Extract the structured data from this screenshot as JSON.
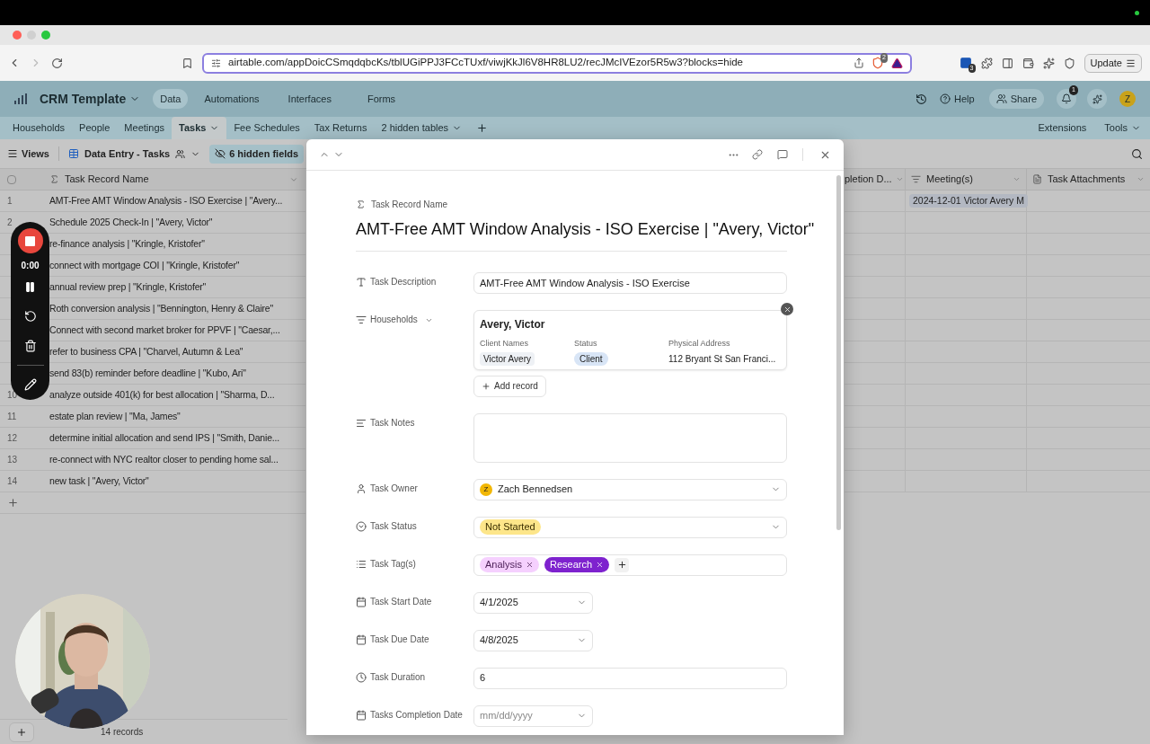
{
  "browser": {
    "url": "airtable.com/appDoicCSmqdqbcKs/tblUGiPPJ3FCcTUxf/viwjKkJl6V8HR8LU2/recJMcIVEzor5R5w3?blocks=hide",
    "shield_count": "2",
    "extension_count": "3",
    "update_label": "Update"
  },
  "app": {
    "base_name": "CRM Template",
    "nav": [
      {
        "label": "Data",
        "selected": true
      },
      {
        "label": "Automations",
        "selected": false
      },
      {
        "label": "Interfaces",
        "selected": false
      },
      {
        "label": "Forms",
        "selected": false
      }
    ],
    "help": "Help",
    "share": "Share",
    "notification_count": "1",
    "avatar_initial": "Z"
  },
  "tables": [
    {
      "label": "Households",
      "selected": false
    },
    {
      "label": "People",
      "selected": false
    },
    {
      "label": "Meetings",
      "selected": false
    },
    {
      "label": "Tasks",
      "selected": true
    },
    {
      "label": "Fee Schedules",
      "selected": false
    },
    {
      "label": "Tax Returns",
      "selected": false
    }
  ],
  "hidden_tables": "2 hidden tables",
  "extensions": "Extensions",
  "tools": "Tools",
  "toolbar": {
    "views": "Views",
    "view_name": "Data Entry - Tasks",
    "hidden_fields": "6 hidden fields"
  },
  "grid": {
    "select_all_checked": false,
    "name_column": "Task Record Name",
    "rows": [
      {
        "number": "1",
        "name": "AMT-Free AMT Window Analysis - ISO Exercise | \"Avery..."
      },
      {
        "number": "2",
        "name": "Schedule 2025 Check-In | \"Avery, Victor\""
      },
      {
        "name": "re-finance analysis | \"Kringle, Kristofer\""
      },
      {
        "name": "connect with mortgage COI | \"Kringle, Kristofer\""
      },
      {
        "name": "annual review prep | \"Kringle, Kristofer\""
      },
      {
        "name": "Roth conversion analysis | \"Bennington, Henry & Claire\""
      },
      {
        "name": "Connect with second market broker for PPVF | \"Caesar,..."
      },
      {
        "name": "refer to business CPA | \"Charvel, Autumn & Lea\""
      },
      {
        "name": "send 83(b) reminder before deadline | \"Kubo, Ari\""
      },
      {
        "number": "10",
        "name": "analyze outside 401(k) for best allocation | \"Sharma, D..."
      },
      {
        "number": "11",
        "name": "estate plan review | \"Ma, James\""
      },
      {
        "number": "12",
        "name": "determine initial allocation and send IPS | \"Smith, Danie..."
      },
      {
        "number": "13",
        "name": "re-connect with NYC realtor closer to pending home sal..."
      },
      {
        "number": "14",
        "name": "new task | \"Avery, Victor\""
      }
    ],
    "right_columns": [
      "pletion D...",
      "Meeting(s)",
      "Task Attachments"
    ],
    "meeting_cell": "2024-12-01 Victor Avery M"
  },
  "recorder": {
    "time": "0:00"
  },
  "footer": {
    "records": "14 records"
  },
  "record": {
    "name_label": "Task Record Name",
    "title": "AMT-Free AMT Window Analysis - ISO Exercise | \"Avery, Victor\"",
    "fields": [
      {
        "kind": "text",
        "label": "Task Description",
        "value": "AMT-Free AMT Window Analysis - ISO Exercise"
      },
      {
        "kind": "link",
        "label": "Households",
        "card_title": "Avery, Victor",
        "columns": [
          {
            "label": "Client Names",
            "value": "Victor Avery",
            "kind": "chip"
          },
          {
            "label": "Status",
            "value": "Client",
            "kind": "chip"
          },
          {
            "label": "Physical Address",
            "value": "112 Bryant St San Franci...",
            "kind": "text"
          }
        ],
        "add_label": "Add record"
      },
      {
        "kind": "notes",
        "label": "Task Notes"
      },
      {
        "kind": "user",
        "label": "Task Owner",
        "initial": "Z",
        "value": "Zach Bennedsen"
      },
      {
        "kind": "status",
        "label": "Task Status",
        "value": "Not Started",
        "color": "#fde68a"
      },
      {
        "kind": "tags",
        "label": "Task Tag(s)",
        "tags": [
          {
            "label": "Analysis",
            "color": "#f5d0fe"
          },
          {
            "label": "Research",
            "color": "#7e22ce"
          }
        ]
      },
      {
        "kind": "date",
        "label": "Task Start Date",
        "value": "4/1/2025"
      },
      {
        "kind": "date",
        "label": "Task Due Date",
        "value": "4/8/2025"
      },
      {
        "kind": "duration",
        "label": "Task Duration",
        "value": "6"
      },
      {
        "kind": "date",
        "label": "Tasks Completion Date",
        "placeholder": "mm/dd/yyyy"
      }
    ]
  }
}
